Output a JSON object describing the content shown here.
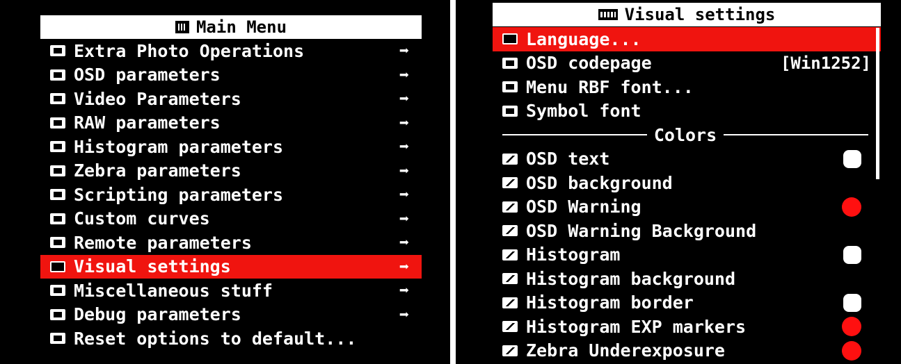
{
  "main_menu": {
    "title": "Main Menu",
    "title_icon": "grid-icon",
    "items": [
      {
        "label": "Extra Photo Operations",
        "icon": "camera-icon",
        "arrow": "➡"
      },
      {
        "label": "OSD parameters",
        "icon": "osd-icon",
        "arrow": "➡"
      },
      {
        "label": "Video Parameters",
        "icon": "video-icon",
        "arrow": "➡"
      },
      {
        "label": "RAW parameters",
        "icon": "raw-icon",
        "arrow": "➡"
      },
      {
        "label": "Histogram parameters",
        "icon": "histogram-icon",
        "arrow": "➡"
      },
      {
        "label": "Zebra parameters",
        "icon": "zebra-icon",
        "arrow": "➡"
      },
      {
        "label": "Scripting parameters",
        "icon": "script-icon",
        "arrow": "➡"
      },
      {
        "label": "Custom curves",
        "icon": "curve-icon",
        "arrow": "➡"
      },
      {
        "label": "Remote parameters",
        "icon": "remote-icon",
        "arrow": "➡"
      },
      {
        "label": "Visual settings",
        "icon": "visual-icon",
        "arrow": "➡",
        "selected": true
      },
      {
        "label": "Miscellaneous stuff",
        "icon": "misc-icon",
        "arrow": "➡"
      },
      {
        "label": "Debug parameters",
        "icon": "debug-icon",
        "arrow": "➡"
      },
      {
        "label": "Reset options to default...",
        "icon": "reset-icon",
        "arrow": ""
      }
    ]
  },
  "visual_settings": {
    "title": "Visual settings",
    "title_icon": "disp-icon",
    "items": [
      {
        "label": "Language...",
        "icon": "folder-icon",
        "selected": true
      },
      {
        "label": "OSD codepage",
        "icon": "codepage-icon",
        "value": "[Win1252]"
      },
      {
        "label": "Menu RBF font...",
        "icon": "folder-icon"
      },
      {
        "label": "Symbol font",
        "icon": "folder-icon"
      }
    ],
    "section_label": "Colors",
    "colors": [
      {
        "label": "OSD text",
        "swatch": "#ffffff"
      },
      {
        "label": "OSD background",
        "swatch": ""
      },
      {
        "label": "OSD Warning",
        "swatch": "#ff1010"
      },
      {
        "label": "OSD Warning Background",
        "swatch": ""
      },
      {
        "label": "Histogram",
        "swatch": "#ffffff"
      },
      {
        "label": "Histogram background",
        "swatch": ""
      },
      {
        "label": "Histogram border",
        "swatch": "#ffffff"
      },
      {
        "label": "Histogram EXP markers",
        "swatch": "#ff1010"
      },
      {
        "label": "Zebra Underexposure",
        "swatch": "#ff1010"
      }
    ]
  },
  "colors": {
    "accent": "#f0140f",
    "background": "#000000",
    "text": "#ffffff"
  }
}
